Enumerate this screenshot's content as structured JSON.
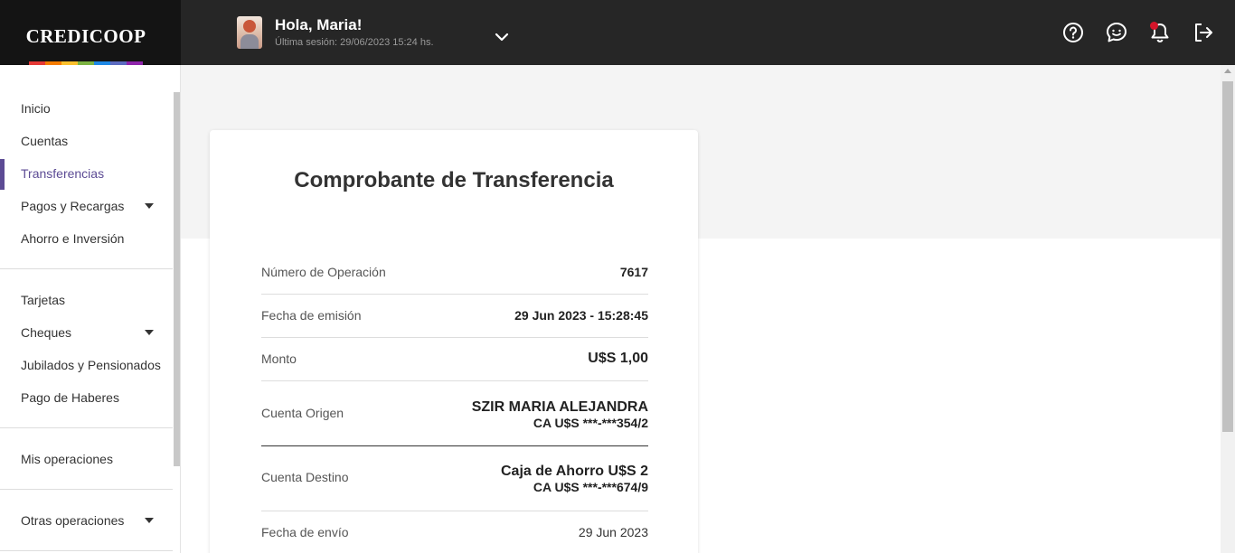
{
  "app": {
    "brand": "CREDICOOP",
    "stripe_colors": [
      "#e53935",
      "#f57c00",
      "#fbc02d",
      "#7cb342",
      "#1e88e5",
      "#5c6bc0",
      "#8e24aa"
    ],
    "accent": "#5c4b94"
  },
  "header": {
    "greeting": "Hola, Maria!",
    "last_session": "Última sesión: 29/06/2023 15:24 hs.",
    "icons": [
      "help-icon",
      "chat-icon",
      "bell-icon",
      "logout-icon"
    ],
    "notification_color": "#d4152a"
  },
  "sidebar": {
    "items": [
      {
        "label": "Inicio"
      },
      {
        "label": "Cuentas"
      },
      {
        "label": "Transferencias"
      },
      {
        "label": "Pagos y Recargas"
      },
      {
        "label": "Ahorro e Inversión"
      },
      {
        "label": "Tarjetas"
      },
      {
        "label": "Cheques"
      },
      {
        "label": "Jubilados y Pensionados"
      },
      {
        "label": "Pago de Haberes"
      },
      {
        "label": "Mis operaciones"
      },
      {
        "label": "Otras operaciones"
      }
    ]
  },
  "receipt": {
    "title": "Comprobante de Transferencia",
    "operation": {
      "label": "Número de Operación",
      "value": "7617"
    },
    "issue_date": {
      "label": "Fecha de emisión",
      "value": "29 Jun 2023 - 15:28:45"
    },
    "amount": {
      "label": "Monto",
      "value": "U$S 1,00"
    },
    "origin": {
      "label": "Cuenta Origen",
      "name": "SZIR MARIA ALEJANDRA",
      "account": "CA U$S ***-***354/2"
    },
    "destination": {
      "label": "Cuenta Destino",
      "name": "Caja de Ahorro U$S 2",
      "account": "CA U$S ***-***674/9"
    },
    "send_date": {
      "label": "Fecha de envío",
      "value": "29 Jun 2023"
    }
  }
}
